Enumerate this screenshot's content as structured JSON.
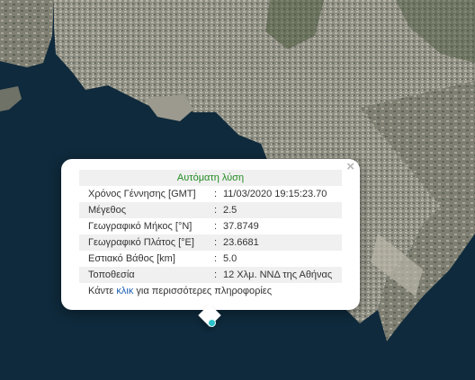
{
  "popup": {
    "title": "Αυτόματη λύση",
    "close_icon": "×",
    "rows": [
      {
        "label": "Χρόνος Γέννησης [GMT]",
        "value": "11/03/2020 19:15:23.70"
      },
      {
        "label": "Μέγεθος",
        "value": "2.5"
      },
      {
        "label": "Γεωγραφικό Μήκος [°N]",
        "value": "37.8749"
      },
      {
        "label": "Γεωγραφικό Πλάτος [°E]",
        "value": "23.6681"
      },
      {
        "label": "Εστιακό Βάθος [km]",
        "value": "5.0"
      },
      {
        "label": "Τοποθεσία",
        "value": "12 Χλμ. ΝΝΔ της Αθήνας"
      }
    ],
    "separator": ":",
    "more_prefix": "Κάντε",
    "more_link": "κλικ",
    "more_suffix": "για περισσότερες πληροφορίες"
  },
  "colors": {
    "title": "#228b22",
    "link": "#1a5fb4",
    "marker": "#2dc2c9",
    "sea": "#0f2a3c",
    "land": "#8a8a7c"
  },
  "marker": {
    "icon": "epicenter-marker"
  }
}
